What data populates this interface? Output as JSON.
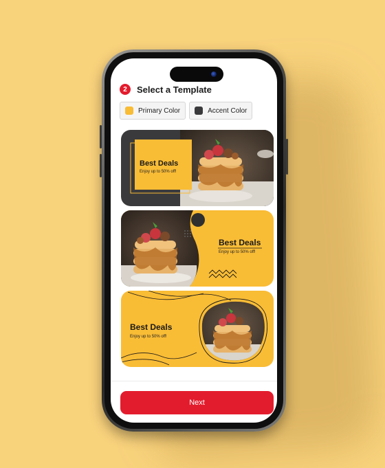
{
  "step": {
    "number": "2",
    "title": "Select a Template"
  },
  "colors": {
    "background": "#f9d27c",
    "primary": "#f9bc35",
    "accent": "#3a3a3c",
    "button": "#e31c2d"
  },
  "chips": [
    {
      "label": "Primary Color",
      "swatch": "#f9bc35"
    },
    {
      "label": "Accent Color",
      "swatch": "#3a3a3c"
    }
  ],
  "templates": [
    {
      "title": "Best Deals",
      "subtitle": "Enjoy up to 50% off!"
    },
    {
      "title": "Best Deals",
      "subtitle": "Enjoy up to 50% off!"
    },
    {
      "title": "Best Deals",
      "subtitle": "Enjoy up to 50% off!"
    }
  ],
  "next_button": {
    "label": "Next"
  }
}
